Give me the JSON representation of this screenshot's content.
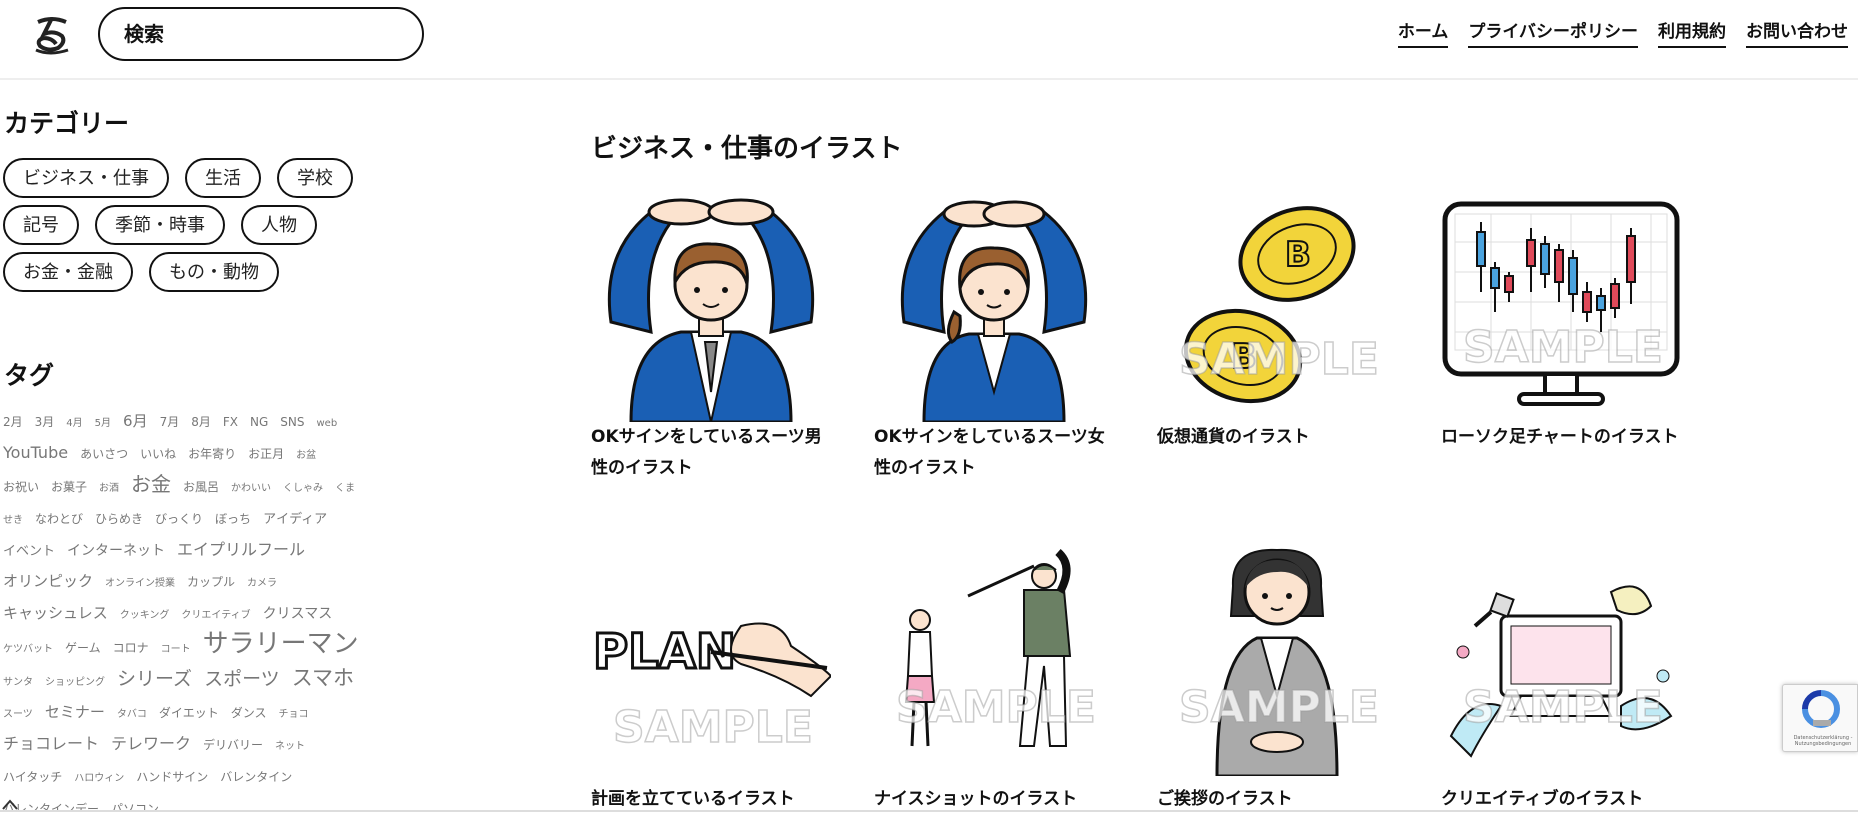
{
  "header": {
    "search_placeholder": "検索",
    "nav": [
      "ホーム",
      "プライバシーポリシー",
      "利用規約",
      "お問い合わせ"
    ]
  },
  "sidebar": {
    "category_title": "カテゴリー",
    "categories": [
      "ビジネス・仕事",
      "生活",
      "学校",
      "記号",
      "季節・時事",
      "人物",
      "お金・金融",
      "もの・動物"
    ],
    "tag_title": "タグ",
    "tags": [
      "2月",
      "3月",
      "4月",
      "5月",
      "6月",
      "7月",
      "8月",
      "FX",
      "NG",
      "SNS",
      "web",
      "YouTube",
      "あいさつ",
      "いいね",
      "お年寄り",
      "お正月",
      "お盆",
      "お祝い",
      "お菓子",
      "お酒",
      "お金",
      "お風呂",
      "かわいい",
      "くしゃみ",
      "くま",
      "せき",
      "なわとび",
      "ひらめき",
      "びっくり",
      "ぼっち",
      "アイディア",
      "イベント",
      "インターネット",
      "エイプリルフール",
      "オリンピック",
      "オンライン授業",
      "カップル",
      "カメラ",
      "キャッシュレス",
      "クッキング",
      "クリエイティブ",
      "クリスマス",
      "ケツバット",
      "ゲーム",
      "コロナ",
      "コート",
      "サラリーマン",
      "サンタ",
      "ショッピング",
      "シリーズ",
      "スポーツ",
      "スマホ",
      "スーツ",
      "セミナー",
      "タバコ",
      "ダイエット",
      "ダンス",
      "チョコ",
      "チョコレート",
      "テレワーク",
      "デリバリー",
      "ネット",
      "ハイタッチ",
      "ハロウィン",
      "ハンドサイン",
      "バレンタイン",
      "バレンタインデー",
      "パソコン"
    ]
  },
  "main": {
    "title": "ビジネス・仕事のイラスト",
    "watermark": "SAMPLE",
    "cards": [
      {
        "caption": "OKサインをしているスーツ男性のイラスト"
      },
      {
        "caption": "OKサインをしているスーツ女性のイラスト"
      },
      {
        "caption": "仮想通貨のイラスト"
      },
      {
        "caption": "ローソク足チャートのイラスト"
      },
      {
        "caption": "計画を立てているイラスト",
        "plan_text": "PLAN"
      },
      {
        "caption": "ナイスショットのイラスト"
      },
      {
        "caption": "ご挨拶のイラスト"
      },
      {
        "caption": "クリエイティブのイラスト"
      }
    ]
  },
  "recaptcha": {
    "text": "Datenschutzerklärung - Nutzungsbedingungen"
  },
  "colors": {
    "accent": "#1a5fb4",
    "coin": "#f2d43a",
    "border": "#111111"
  }
}
